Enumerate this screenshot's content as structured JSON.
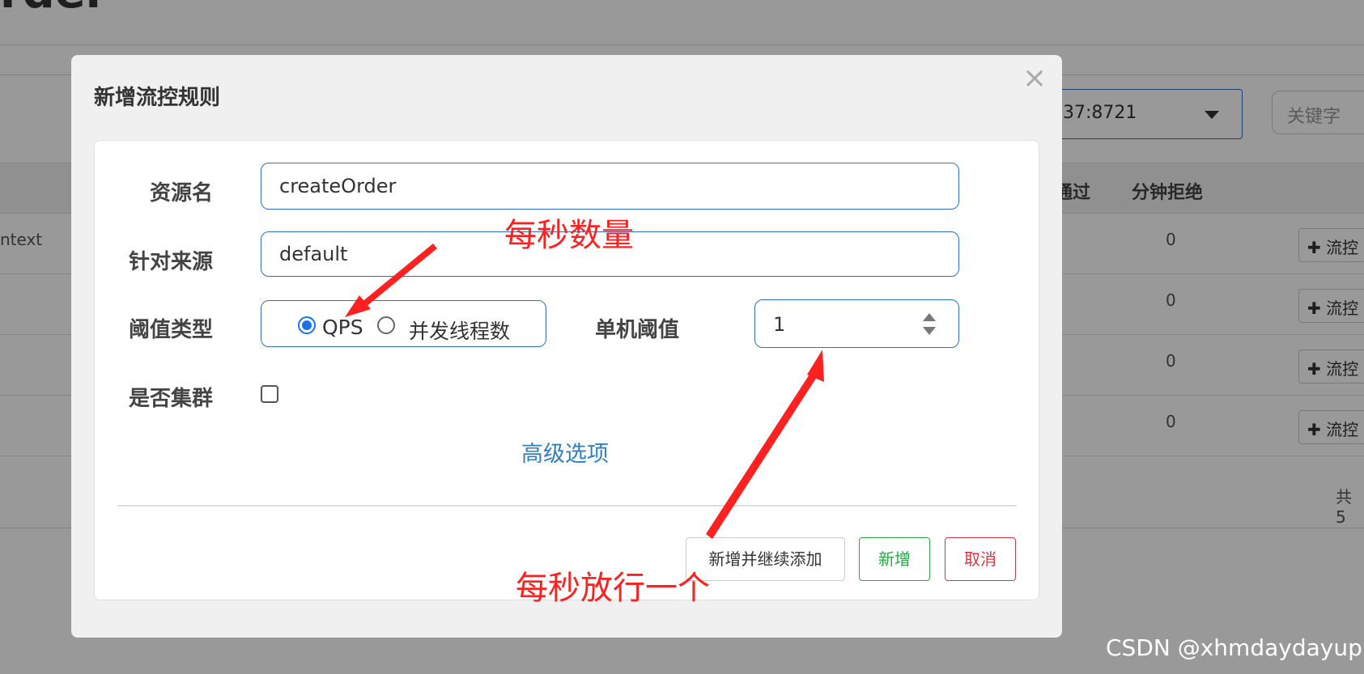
{
  "background": {
    "page_title_fragment": "rder",
    "machine_select_value": "37:8721",
    "keyword_placeholder": "关键字",
    "columns": [
      "通过",
      "分钟拒绝"
    ],
    "rows": [
      {
        "context": "ntext",
        "reject": "0",
        "action": "流控"
      },
      {
        "context": "",
        "reject": "0",
        "action": "流控"
      },
      {
        "context": "",
        "reject": "0",
        "action": "流控"
      },
      {
        "context": "",
        "reject": "0",
        "action": "流控"
      }
    ],
    "total_fragment": "共 5"
  },
  "modal": {
    "title": "新增流控规则",
    "close_symbol": "×",
    "fields": {
      "resource_label": "资源名",
      "resource_value": "createOrder",
      "source_label": "针对来源",
      "source_value": "default",
      "threshold_type_label": "阈值类型",
      "threshold_type_options": [
        "QPS",
        "并发线程数"
      ],
      "threshold_type_selected": "QPS",
      "threshold_label": "单机阈值",
      "threshold_value": "1",
      "cluster_label": "是否集群"
    },
    "advanced_link": "高级选项",
    "buttons": {
      "add_continue": "新增并继续添加",
      "add": "新增",
      "cancel": "取消"
    }
  },
  "annotations": {
    "qps_note": "每秒数量",
    "threshold_note": "每秒放行一个",
    "color": "#ff2020"
  },
  "watermark": "CSDN @xhmdaydayup"
}
